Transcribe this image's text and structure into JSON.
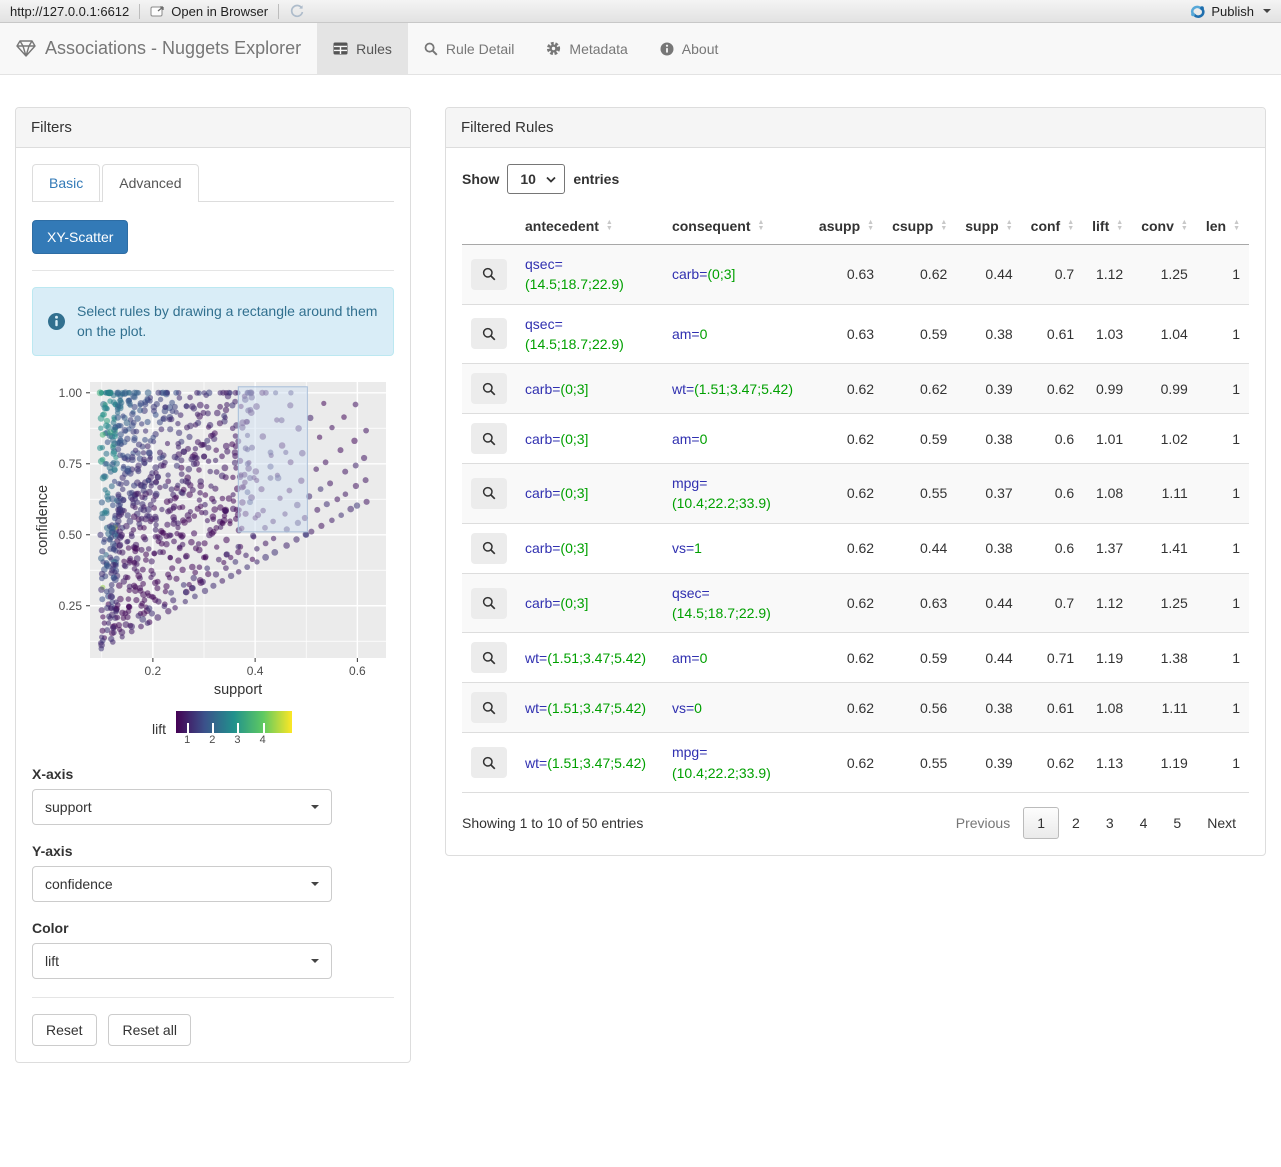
{
  "viewer_bar": {
    "url": "http://127.0.0.1:6612",
    "open_in_browser": "Open in Browser",
    "publish_label": "Publish"
  },
  "navbar": {
    "brand": "Associations - Nuggets Explorer",
    "brand_icon": "gem-icon",
    "tabs": [
      {
        "label": "Rules",
        "icon": "table-icon",
        "active": true
      },
      {
        "label": "Rule Detail",
        "icon": "search-icon",
        "active": false
      },
      {
        "label": "Metadata",
        "icon": "gear-icon",
        "active": false
      },
      {
        "label": "About",
        "icon": "info-icon",
        "active": false
      }
    ]
  },
  "filters": {
    "title": "Filters",
    "tabs": [
      {
        "label": "Basic",
        "active": false
      },
      {
        "label": "Advanced",
        "active": true
      }
    ],
    "scatter_button": "XY-Scatter",
    "info_text": "Select rules by drawing a rectangle around them on the plot.",
    "x_axis": {
      "label": "X-axis",
      "value": "support"
    },
    "y_axis": {
      "label": "Y-axis",
      "value": "confidence"
    },
    "color": {
      "label": "Color",
      "value": "lift"
    },
    "reset_label": "Reset",
    "reset_all_label": "Reset all"
  },
  "chart_data": {
    "type": "scatter",
    "xlabel": "support",
    "ylabel": "confidence",
    "xlim": [
      0.077,
      0.656
    ],
    "ylim": [
      0.066,
      1.038
    ],
    "x_ticks": [
      0.2,
      0.4,
      0.6
    ],
    "y_ticks": [
      0.25,
      0.5,
      0.75,
      1.0
    ],
    "panel_bg": "#ebebeb",
    "grid_color": "#ffffff",
    "color_label": "lift",
    "color_ticks": [
      1,
      2,
      3,
      4
    ],
    "color_tick_pos_pct": [
      9.6,
      31.3,
      53.0,
      74.7
    ],
    "colormap": "viridis",
    "colormap_stops": [
      "#440154",
      "#3b528b",
      "#21918c",
      "#5ec962",
      "#fde725"
    ],
    "selection_rect": {
      "x0": 0.367,
      "x1": 0.502,
      "y0": 0.51,
      "y1": 1.021
    },
    "point_alpha": 0.55,
    "points_note": "Dense viridis-colored cloud of association rules: support mostly 0.1-0.35, confidence 0.1-1.0, bounded below by confidence=support diagonal rays; a row of points at confidence=1.0 up to support 0.47; sparse diagonal points out to (0.63, 0.62); a few points inside the blue selection brush.",
    "generator": {
      "seed": 42,
      "n_cluster": 650,
      "n_top_row": 45,
      "ray_slopes": [
        1.0,
        1.12,
        1.25,
        1.4,
        1.6,
        1.8,
        2.05,
        2.35,
        2.7,
        3.1,
        3.6,
        4.2
      ]
    }
  },
  "rules_table": {
    "title": "Filtered Rules",
    "show_label": "Show",
    "page_length": "10",
    "entries_label": "entries",
    "columns": [
      "antecedent",
      "consequent",
      "asupp",
      "csupp",
      "supp",
      "conf",
      "lift",
      "conv",
      "len"
    ],
    "attr_color": "#3030b0",
    "value_color": "#00a000",
    "rows": [
      {
        "antecedent": {
          "attr": "qsec=",
          "val": "(14.5;18.7;22.9)"
        },
        "consequent": {
          "attr": "carb=",
          "val": "(0;3]"
        },
        "asupp": "0.63",
        "csupp": "0.62",
        "supp": "0.44",
        "conf": "0.7",
        "lift": "1.12",
        "conv": "1.25",
        "len": "1"
      },
      {
        "antecedent": {
          "attr": "qsec=",
          "val": "(14.5;18.7;22.9)"
        },
        "consequent": {
          "attr": "am=",
          "val": "0"
        },
        "asupp": "0.63",
        "csupp": "0.59",
        "supp": "0.38",
        "conf": "0.61",
        "lift": "1.03",
        "conv": "1.04",
        "len": "1"
      },
      {
        "antecedent": {
          "attr": "carb=",
          "val": "(0;3]"
        },
        "consequent": {
          "attr": "wt=",
          "val": "(1.51;3.47;5.42)"
        },
        "asupp": "0.62",
        "csupp": "0.62",
        "supp": "0.39",
        "conf": "0.62",
        "lift": "0.99",
        "conv": "0.99",
        "len": "1"
      },
      {
        "antecedent": {
          "attr": "carb=",
          "val": "(0;3]"
        },
        "consequent": {
          "attr": "am=",
          "val": "0"
        },
        "asupp": "0.62",
        "csupp": "0.59",
        "supp": "0.38",
        "conf": "0.6",
        "lift": "1.01",
        "conv": "1.02",
        "len": "1"
      },
      {
        "antecedent": {
          "attr": "carb=",
          "val": "(0;3]"
        },
        "consequent": {
          "attr": "mpg=",
          "val": "(10.4;22.2;33.9)"
        },
        "asupp": "0.62",
        "csupp": "0.55",
        "supp": "0.37",
        "conf": "0.6",
        "lift": "1.08",
        "conv": "1.11",
        "len": "1"
      },
      {
        "antecedent": {
          "attr": "carb=",
          "val": "(0;3]"
        },
        "consequent": {
          "attr": "vs=",
          "val": "1"
        },
        "asupp": "0.62",
        "csupp": "0.44",
        "supp": "0.38",
        "conf": "0.6",
        "lift": "1.37",
        "conv": "1.41",
        "len": "1"
      },
      {
        "antecedent": {
          "attr": "carb=",
          "val": "(0;3]"
        },
        "consequent": {
          "attr": "qsec=",
          "val": "(14.5;18.7;22.9)"
        },
        "asupp": "0.62",
        "csupp": "0.63",
        "supp": "0.44",
        "conf": "0.7",
        "lift": "1.12",
        "conv": "1.25",
        "len": "1"
      },
      {
        "antecedent": {
          "attr": "wt=",
          "val": "(1.51;3.47;5.42)"
        },
        "consequent": {
          "attr": "am=",
          "val": "0"
        },
        "asupp": "0.62",
        "csupp": "0.59",
        "supp": "0.44",
        "conf": "0.71",
        "lift": "1.19",
        "conv": "1.38",
        "len": "1"
      },
      {
        "antecedent": {
          "attr": "wt=",
          "val": "(1.51;3.47;5.42)"
        },
        "consequent": {
          "attr": "vs=",
          "val": "0"
        },
        "asupp": "0.62",
        "csupp": "0.56",
        "supp": "0.38",
        "conf": "0.61",
        "lift": "1.08",
        "conv": "1.11",
        "len": "1"
      },
      {
        "antecedent": {
          "attr": "wt=",
          "val": "(1.51;3.47;5.42)"
        },
        "consequent": {
          "attr": "mpg=",
          "val": "(10.4;22.2;33.9)"
        },
        "asupp": "0.62",
        "csupp": "0.55",
        "supp": "0.39",
        "conf": "0.62",
        "lift": "1.13",
        "conv": "1.19",
        "len": "1"
      }
    ],
    "info": "Showing 1 to 10 of 50 entries",
    "pagination": {
      "previous": "Previous",
      "pages": [
        "1",
        "2",
        "3",
        "4",
        "5"
      ],
      "current": "1",
      "next": "Next"
    }
  }
}
